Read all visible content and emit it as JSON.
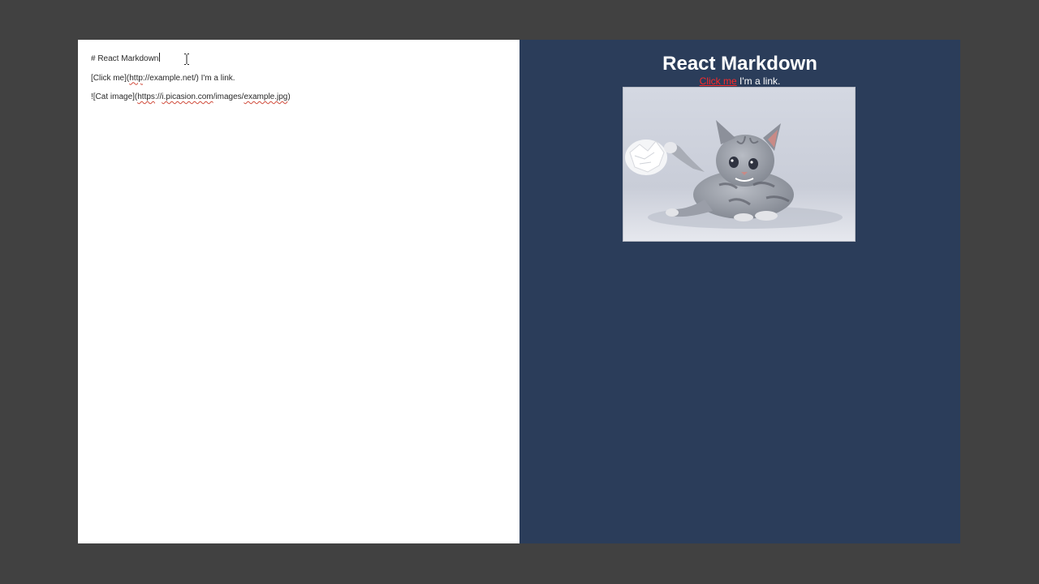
{
  "editor": {
    "lines": [
      {
        "parts": [
          "# React Markdown"
        ]
      },
      {
        "parts": [
          "[Click me](",
          "http",
          "://example.net/) I'm a link."
        ]
      },
      {
        "parts": [
          "![Cat image](",
          "https",
          "://",
          "i.picasion.com",
          "/images/",
          "example.jpg",
          ")"
        ]
      }
    ]
  },
  "preview": {
    "heading": "React Markdown",
    "link_text": "Click me",
    "after_link": " I'm a link.",
    "image_alt": "Cat image"
  },
  "colors": {
    "background": "#414141",
    "editor_bg": "#ffffff",
    "preview_bg": "#2b3d5a",
    "link": "#ff2a2a",
    "spellcheck": "#d04a3a"
  }
}
